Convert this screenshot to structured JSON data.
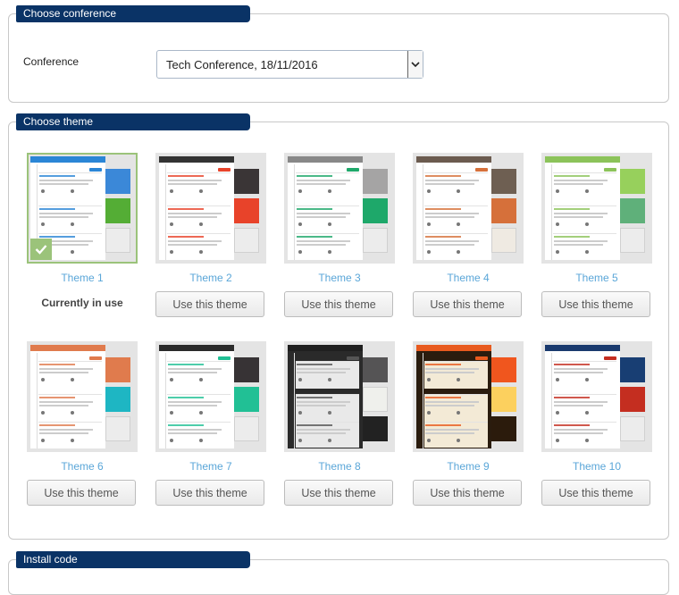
{
  "conference_section": {
    "header": "Choose conference",
    "label": "Conference",
    "selected": "Tech Conference, 18/11/2016"
  },
  "theme_section": {
    "header": "Choose theme",
    "current_label": "Currently in use",
    "button_label": "Use this theme",
    "themes": [
      {
        "name": "Theme 1",
        "bar": "#2b86d6",
        "accent": "#2b86d6",
        "dark": false,
        "swatches": [
          "#3b88d8",
          "#54ad35",
          "#ececec"
        ],
        "selected": true
      },
      {
        "name": "Theme 2",
        "bar": "#333333",
        "accent": "#e8432a",
        "dark": false,
        "swatches": [
          "#3a3536",
          "#e8432a",
          "#ececec"
        ],
        "selected": false
      },
      {
        "name": "Theme 3",
        "bar": "#888888",
        "accent": "#1ea86a",
        "dark": false,
        "swatches": [
          "#a5a4a4",
          "#1ea86a",
          "#ececec"
        ],
        "selected": false
      },
      {
        "name": "Theme 4",
        "bar": "#6b5b4f",
        "accent": "#d6703a",
        "dark": false,
        "swatches": [
          "#6e5f52",
          "#d6703a",
          "#efeae2"
        ],
        "selected": false
      },
      {
        "name": "Theme 5",
        "bar": "#8cc35a",
        "accent": "#8cc35a",
        "dark": false,
        "swatches": [
          "#97d05c",
          "#5fb07a",
          "#ececec"
        ],
        "selected": false
      },
      {
        "name": "Theme 6",
        "bar": "#e07b4d",
        "accent": "#e07b4d",
        "dark": false,
        "swatches": [
          "#e07b4d",
          "#1eb6c3",
          "#ececec"
        ],
        "selected": false
      },
      {
        "name": "Theme 7",
        "bar": "#2b2b2b",
        "accent": "#21c095",
        "dark": false,
        "swatches": [
          "#373335",
          "#21c095",
          "#ececec"
        ],
        "selected": false
      },
      {
        "name": "Theme 8",
        "bar": "#1f1f1f",
        "accent": "#555555",
        "dark": true,
        "swatches": [
          "#555455",
          "#eff0ec",
          "#222222"
        ],
        "selected": false
      },
      {
        "name": "Theme 9",
        "bar": "#e85a1e",
        "accent": "#e85a1e",
        "dark": true,
        "swatches": [
          "#f0561e",
          "#fcd05e",
          "#2b1b0c"
        ],
        "selected": false
      },
      {
        "name": "Theme 10",
        "bar": "#1a3a6e",
        "accent": "#c42e20",
        "dark": false,
        "swatches": [
          "#183e73",
          "#c42e20",
          "#ececec"
        ],
        "selected": false
      }
    ]
  },
  "install_section": {
    "header": "Install code"
  }
}
